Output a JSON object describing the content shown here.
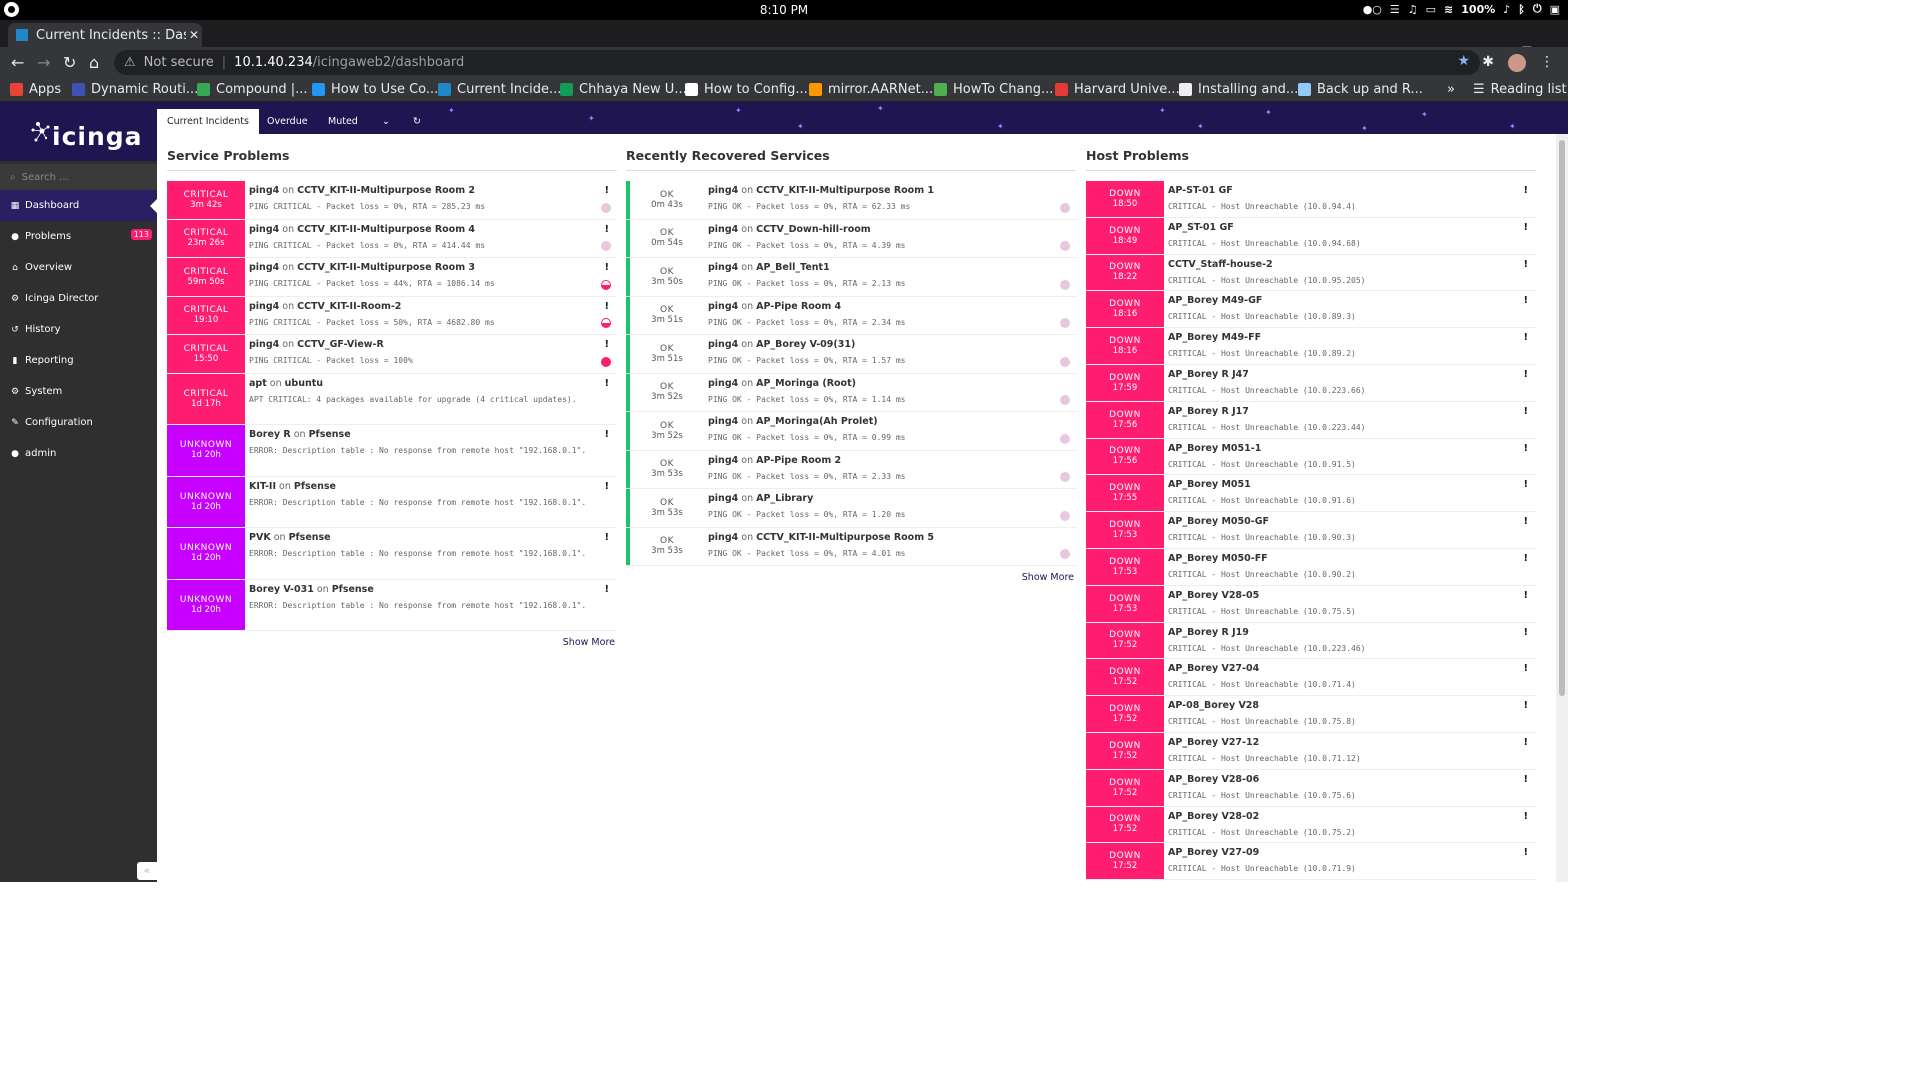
{
  "os": {
    "clock": "8:10 PM",
    "battery": "100%"
  },
  "browser": {
    "tab_title": "Current Incidents :: Dashl",
    "url_warning": "Not secure",
    "url_host": "10.1.40.234",
    "url_path": "/icingaweb2/dashboard",
    "bookmarks": [
      {
        "label": "Apps",
        "color": "#ea4335"
      },
      {
        "label": "Dynamic Routi...",
        "color": "#3f51b5"
      },
      {
        "label": "Compound |...",
        "color": "#34a853"
      },
      {
        "label": "How to Use Co...",
        "color": "#2196f3"
      },
      {
        "label": "Current Incide...",
        "color": "#1e88c8"
      },
      {
        "label": "Chhaya New U...",
        "color": "#0f9d58"
      },
      {
        "label": "How to Config...",
        "color": "#ffffff"
      },
      {
        "label": "mirror.AARNet...",
        "color": "#ff9800"
      },
      {
        "label": "HowTo Chang...",
        "color": "#4caf50"
      },
      {
        "label": "Harvard Unive...",
        "color": "#e53935"
      },
      {
        "label": "Installing and...",
        "color": "#eeeeee"
      },
      {
        "label": "Back up and R...",
        "color": "#90caf9"
      }
    ],
    "reading_list": "Reading list"
  },
  "sidebar": {
    "logo": "icinga",
    "search_placeholder": "Search ...",
    "items": [
      {
        "label": "Dashboard",
        "icon": "▦",
        "icon_name": "grid-icon"
      },
      {
        "label": "Problems",
        "icon": "●",
        "icon_name": "alert-icon",
        "badge": "113"
      },
      {
        "label": "Overview",
        "icon": "⌂",
        "icon_name": "binoculars-icon"
      },
      {
        "label": "Icinga Director",
        "icon": "⚙",
        "icon_name": "sitemap-icon"
      },
      {
        "label": "History",
        "icon": "↺",
        "icon_name": "history-icon"
      },
      {
        "label": "Reporting",
        "icon": "▮",
        "icon_name": "chart-icon"
      },
      {
        "label": "System",
        "icon": "⚙",
        "icon_name": "cogs-icon"
      },
      {
        "label": "Configuration",
        "icon": "✎",
        "icon_name": "wrench-icon"
      },
      {
        "label": "admin",
        "icon": "●",
        "icon_name": "user-icon"
      }
    ]
  },
  "tabs": [
    "Current Incidents",
    "Overdue",
    "Muted"
  ],
  "service_problems": {
    "title": "Service Problems",
    "rows": [
      {
        "state": "CRITICAL",
        "time": "3m 42s",
        "svc": "ping4",
        "host": "CCTV_KIT-II-Multipurpose Room 2",
        "out": "PING CRITICAL - Packet loss = 0%, RTA = 285.23 ms",
        "dot": "pink"
      },
      {
        "state": "CRITICAL",
        "time": "23m 26s",
        "svc": "ping4",
        "host": "CCTV_KIT-II-Multipurpose Room 4",
        "out": "PING CRITICAL - Packet loss = 0%, RTA = 414.44 ms",
        "dot": "pink"
      },
      {
        "state": "CRITICAL",
        "time": "59m 50s",
        "svc": "ping4",
        "host": "CCTV_KIT-II-Multipurpose Room 3",
        "out": "PING CRITICAL - Packet loss = 44%, RTA = 1086.14 ms",
        "dot": "half"
      },
      {
        "state": "CRITICAL",
        "time": "19:10",
        "svc": "ping4",
        "host": "CCTV_KIT-II-Room-2",
        "out": "PING CRITICAL - Packet loss = 50%, RTA = 4682.80 ms",
        "dot": "half"
      },
      {
        "state": "CRITICAL",
        "time": "15:50",
        "svc": "ping4",
        "host": "CCTV_GF-View-R",
        "out": "PING CRITICAL - Packet loss = 100%",
        "dot": "full"
      },
      {
        "state": "CRITICAL",
        "time": "1d 17h",
        "svc": "apt",
        "host": "ubuntu",
        "out": "APT CRITICAL: 4 packages available for upgrade (4 critical updates).",
        "dot": ""
      },
      {
        "state": "UNKNOWN",
        "time": "1d 20h",
        "svc": "Borey R",
        "host": "Pfsense",
        "out": "ERROR: Description table : No response from remote host \"192.168.0.1\".",
        "dot": ""
      },
      {
        "state": "UNKNOWN",
        "time": "1d 20h",
        "svc": "KIT-II",
        "host": "Pfsense",
        "out": "ERROR: Description table : No response from remote host \"192.168.0.1\".",
        "dot": ""
      },
      {
        "state": "UNKNOWN",
        "time": "1d 20h",
        "svc": "PVK",
        "host": "Pfsense",
        "out": "ERROR: Description table : No response from remote host \"192.168.0.1\".",
        "dot": ""
      },
      {
        "state": "UNKNOWN",
        "time": "1d 20h",
        "svc": "Borey V-031",
        "host": "Pfsense",
        "out": "ERROR: Description table : No response from remote host \"192.168.0.1\".",
        "dot": ""
      }
    ],
    "show_more": "Show More"
  },
  "recovered": {
    "title": "Recently Recovered Services",
    "rows": [
      {
        "state": "OK",
        "time": "0m 43s",
        "svc": "ping4",
        "host": "CCTV_KIT-II-Multipurpose Room 1",
        "out": "PING OK - Packet loss = 0%, RTA = 62.33 ms"
      },
      {
        "state": "OK",
        "time": "0m 54s",
        "svc": "ping4",
        "host": "CCTV_Down-hill-room",
        "out": "PING OK - Packet loss = 0%, RTA = 4.39 ms"
      },
      {
        "state": "OK",
        "time": "3m 50s",
        "svc": "ping4",
        "host": "AP_Bell_Tent1",
        "out": "PING OK - Packet loss = 0%, RTA = 2.13 ms"
      },
      {
        "state": "OK",
        "time": "3m 51s",
        "svc": "ping4",
        "host": "AP-Pipe Room 4",
        "out": "PING OK - Packet loss = 0%, RTA = 2.34 ms"
      },
      {
        "state": "OK",
        "time": "3m 51s",
        "svc": "ping4",
        "host": "AP_Borey V-09(31)",
        "out": "PING OK - Packet loss = 0%, RTA = 1.57 ms"
      },
      {
        "state": "OK",
        "time": "3m 52s",
        "svc": "ping4",
        "host": "AP_Moringa (Root)",
        "out": "PING OK - Packet loss = 0%, RTA = 1.14 ms"
      },
      {
        "state": "OK",
        "time": "3m 52s",
        "svc": "ping4",
        "host": "AP_Moringa(Ah Prolet)",
        "out": "PING OK - Packet loss = 0%, RTA = 0.99 ms"
      },
      {
        "state": "OK",
        "time": "3m 53s",
        "svc": "ping4",
        "host": "AP-Pipe Room 2",
        "out": "PING OK - Packet loss = 0%, RTA = 2.33 ms"
      },
      {
        "state": "OK",
        "time": "3m 53s",
        "svc": "ping4",
        "host": "AP_Library",
        "out": "PING OK - Packet loss = 0%, RTA = 1.20 ms"
      },
      {
        "state": "OK",
        "time": "3m 53s",
        "svc": "ping4",
        "host": "CCTV_KIT-II-Multipurpose Room 5",
        "out": "PING OK - Packet loss = 0%, RTA = 4.01 ms"
      }
    ],
    "show_more": "Show More"
  },
  "host_problems": {
    "title": "Host Problems",
    "rows": [
      {
        "state": "DOWN",
        "time": "18:50",
        "host": "AP-ST-01 GF",
        "out": "CRITICAL - Host Unreachable (10.0.94.4)"
      },
      {
        "state": "DOWN",
        "time": "18:49",
        "host": "AP_ST-01 GF",
        "out": "CRITICAL - Host Unreachable (10.0.94.68)"
      },
      {
        "state": "DOWN",
        "time": "18:22",
        "host": "CCTV_Staff-house-2",
        "out": "CRITICAL - Host Unreachable (10.0.95.205)"
      },
      {
        "state": "DOWN",
        "time": "18:16",
        "host": "AP_Borey M49-GF",
        "out": "CRITICAL - Host Unreachable (10.0.89.3)"
      },
      {
        "state": "DOWN",
        "time": "18:16",
        "host": "AP_Borey M49-FF",
        "out": "CRITICAL - Host Unreachable (10.0.89.2)"
      },
      {
        "state": "DOWN",
        "time": "17:59",
        "host": "AP_Borey R J47",
        "out": "CRITICAL - Host Unreachable (10.0.223.66)"
      },
      {
        "state": "DOWN",
        "time": "17:56",
        "host": "AP_Borey R J17",
        "out": "CRITICAL - Host Unreachable (10.0.223.44)"
      },
      {
        "state": "DOWN",
        "time": "17:56",
        "host": "AP_Borey M051-1",
        "out": "CRITICAL - Host Unreachable (10.0.91.5)"
      },
      {
        "state": "DOWN",
        "time": "17:55",
        "host": "AP_Borey M051",
        "out": "CRITICAL - Host Unreachable (10.0.91.6)"
      },
      {
        "state": "DOWN",
        "time": "17:53",
        "host": "AP_Borey M050-GF",
        "out": "CRITICAL - Host Unreachable (10.0.90.3)"
      },
      {
        "state": "DOWN",
        "time": "17:53",
        "host": "AP_Borey M050-FF",
        "out": "CRITICAL - Host Unreachable (10.0.90.2)"
      },
      {
        "state": "DOWN",
        "time": "17:53",
        "host": "AP_Borey V28-05",
        "out": "CRITICAL - Host Unreachable (10.0.75.5)"
      },
      {
        "state": "DOWN",
        "time": "17:52",
        "host": "AP_Borey R J19",
        "out": "CRITICAL - Host Unreachable (10.0.223.46)"
      },
      {
        "state": "DOWN",
        "time": "17:52",
        "host": "AP_Borey V27-04",
        "out": "CRITICAL - Host Unreachable (10.0.71.4)"
      },
      {
        "state": "DOWN",
        "time": "17:52",
        "host": "AP-08_Borey V28",
        "out": "CRITICAL - Host Unreachable (10.0.75.8)"
      },
      {
        "state": "DOWN",
        "time": "17:52",
        "host": "AP_Borey V27-12",
        "out": "CRITICAL - Host Unreachable (10.0.71.12)"
      },
      {
        "state": "DOWN",
        "time": "17:52",
        "host": "AP_Borey V28-06",
        "out": "CRITICAL - Host Unreachable (10.0.75.6)"
      },
      {
        "state": "DOWN",
        "time": "17:52",
        "host": "AP_Borey V28-02",
        "out": "CRITICAL - Host Unreachable (10.0.75.2)"
      },
      {
        "state": "DOWN",
        "time": "17:52",
        "host": "AP_Borey V27-09",
        "out": "CRITICAL - Host Unreachable (10.0.71.9)"
      }
    ]
  },
  "colors": {
    "critical": "#ff1d6f",
    "unknown": "#c700ff",
    "ok": "#1bc66b",
    "brand": "#1e1551"
  }
}
